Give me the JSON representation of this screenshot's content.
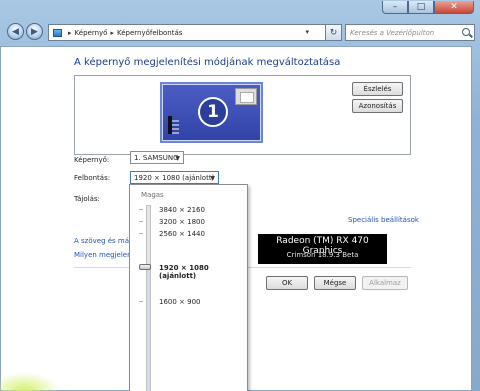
{
  "nav": {
    "back_icon": "back-arrow-icon",
    "forward_icon": "forward-arrow-icon",
    "breadcrumb": [
      "Képernyő",
      "Képernyőfelbontás"
    ],
    "search_placeholder": "Keresés a Vezérlőpulton"
  },
  "window_controls": {
    "minimize": "–",
    "maximize": "□",
    "close": "✕"
  },
  "page": {
    "title": "A képernyő megjelenítési módjának megváltoztatása"
  },
  "preview": {
    "monitor_number": "1",
    "detect_button": "Észlelés",
    "identify_button": "Azonosítás"
  },
  "settings": {
    "display_label": "Képernyő:",
    "display_value": "1. SAMSUNG",
    "resolution_label": "Felbontás:",
    "resolution_value": "1920 × 1080 (ajánlott)",
    "orientation_label": "Tájolás:"
  },
  "advanced_link": "Speciális beállítások",
  "links": {
    "text_size": "A szöveg és más e",
    "which_settings": "Milyen megjeleníté"
  },
  "buttons": {
    "ok": "OK",
    "cancel": "Mégse",
    "apply": "Alkalmaz"
  },
  "slider": {
    "high_label": "Magas",
    "resolutions": [
      "3840 × 2160",
      "3200 × 1800",
      "2560 × 1440",
      "1920 × 1080 (ajánlott)",
      "1600 × 900"
    ],
    "selected": "1920 × 1080 (ajánlott)"
  },
  "overlay": {
    "gpu": "Radeon (TM) RX 470 Graphics",
    "driver": "Crimson 18.9.3 Beta"
  },
  "colors": {
    "link": "#1f54b8",
    "title": "#1a3e8c",
    "window": "#8fb3d6"
  }
}
